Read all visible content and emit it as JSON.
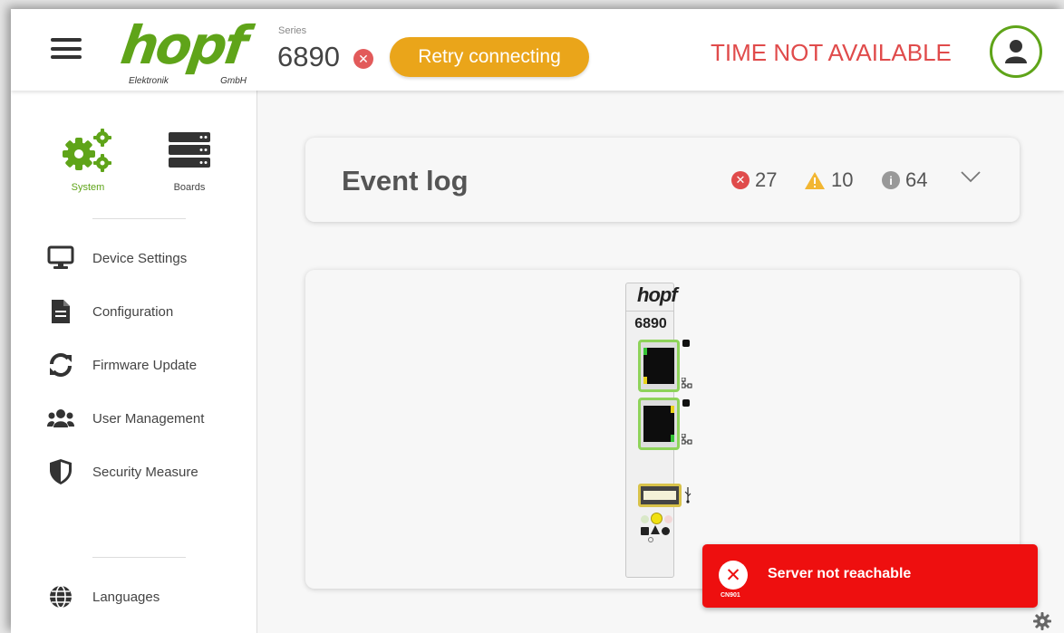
{
  "brand": {
    "logo_text": "hopf",
    "sub_left": "Elektronik",
    "sub_right": "GmbH"
  },
  "header": {
    "series_label": "Series",
    "series_value": "6890",
    "retry_label": "Retry connecting",
    "time_status": "TIME NOT AVAILABLE"
  },
  "sidebar": {
    "tabs": [
      {
        "label": "System",
        "active": true,
        "icon": "gears-icon"
      },
      {
        "label": "Boards",
        "active": false,
        "icon": "server-icon"
      }
    ],
    "items": [
      {
        "label": "Device Settings",
        "icon": "monitor-icon"
      },
      {
        "label": "Configuration",
        "icon": "document-icon"
      },
      {
        "label": "Firmware Update",
        "icon": "sync-icon"
      },
      {
        "label": "User Management",
        "icon": "users-icon"
      },
      {
        "label": "Security Measure",
        "icon": "shield-icon"
      }
    ],
    "languages_label": "Languages"
  },
  "event_log": {
    "title": "Event log",
    "errors": "27",
    "warnings": "10",
    "infos": "64"
  },
  "device": {
    "logo": "hopf",
    "model": "6890"
  },
  "toast": {
    "message": "Server not reachable",
    "code": "CN901"
  },
  "colors": {
    "brand_green": "#5fa419",
    "retry_orange": "#eaa51a",
    "error_red": "#e04b4b",
    "toast_red": "#ee0f0f",
    "warning_yellow": "#f2b632",
    "info_gray": "#999999"
  }
}
